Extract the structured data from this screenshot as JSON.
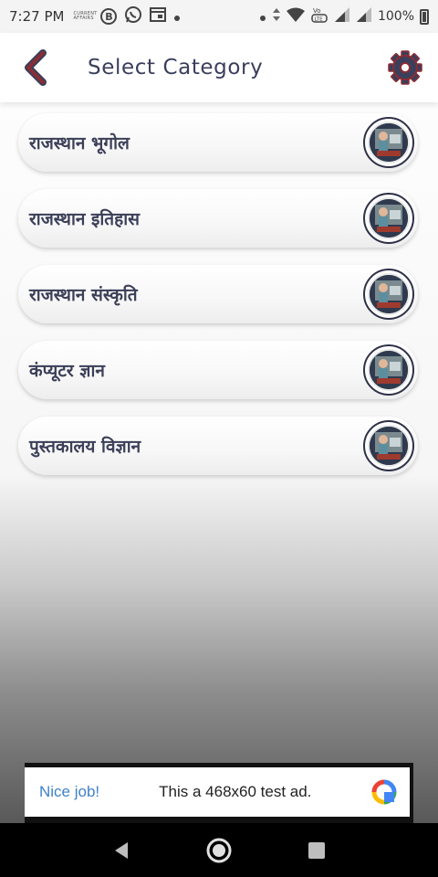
{
  "status_bar": {
    "time": "7:27 PM",
    "tiny_label": "CURRENT AFFAIRS",
    "b_icon_letter": "B",
    "battery": "100%",
    "icons": [
      "current-affairs-icon",
      "b-circle-icon",
      "whatsapp-icon",
      "calendar-icon",
      "dot-icon",
      "dot-icon",
      "data-arrows-icon",
      "wifi-icon",
      "volte-icon",
      "signal-icon",
      "signal-icon",
      "battery-icon"
    ]
  },
  "app_bar": {
    "title": "Select Category",
    "accent_color": "#8b2d34",
    "settings_color": "#3a3f5c"
  },
  "categories": [
    {
      "label": "राजस्थान भूगोल"
    },
    {
      "label": "राजस्थान इतिहास"
    },
    {
      "label": "राजस्थान संस्कृति"
    },
    {
      "label": "कंप्यूटर ज्ञान"
    },
    {
      "label": "पुस्तकालय विज्ञान"
    }
  ],
  "ad": {
    "left_text": "Nice job!",
    "main_text": "This a 468x60 test ad."
  },
  "nav": {
    "icons": [
      "back-triangle-icon",
      "home-circle-icon",
      "recents-square-icon"
    ]
  }
}
